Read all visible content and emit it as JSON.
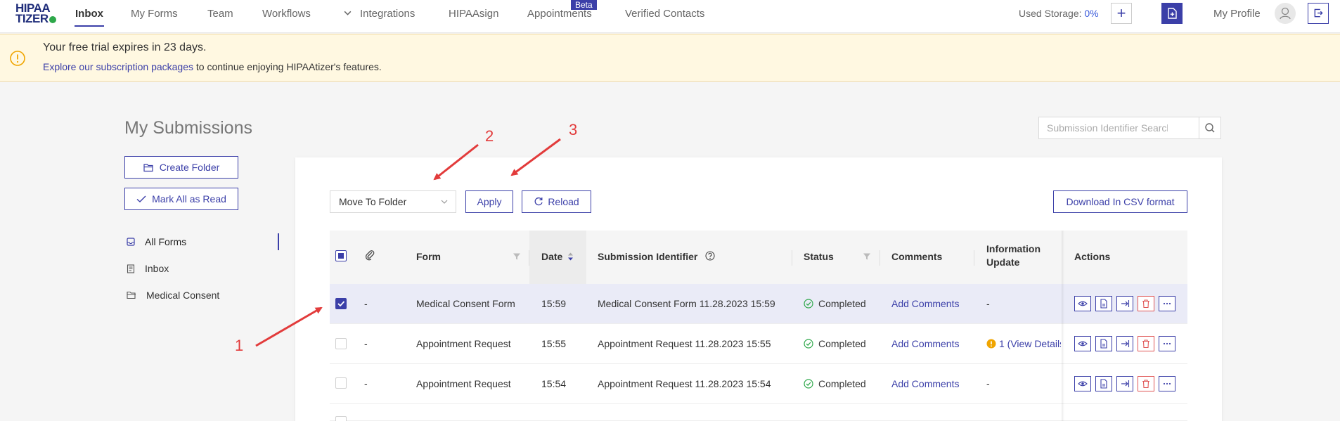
{
  "nav": {
    "logo_line1": "HIPAA",
    "logo_line2": "TIZER",
    "items": [
      "Inbox",
      "My Forms",
      "Team",
      "Workflows",
      "Integrations",
      "HIPAAsign",
      "Appointments",
      "Verified Contacts"
    ],
    "beta_badge": "Beta",
    "storage_label": "Used Storage:",
    "storage_value": "0%",
    "profile": "My Profile"
  },
  "banner": {
    "title": "Your free trial expires in 23 days.",
    "link": "Explore our subscription packages",
    "rest": " to continue enjoying HIPAAtizer's features."
  },
  "sidebar": {
    "title": "My Submissions",
    "create_folder": "Create Folder",
    "mark_all_read": "Mark All as Read",
    "folders": [
      "All Forms",
      "Inbox",
      "Medical Consent"
    ]
  },
  "search": {
    "placeholder": "Submission Identifier Search"
  },
  "toolbar": {
    "move_to_folder": "Move To Folder",
    "apply": "Apply",
    "reload": "Reload",
    "download_csv": "Download In CSV format"
  },
  "table": {
    "headers": {
      "form": "Form",
      "date": "Date",
      "identifier": "Submission Identifier",
      "status": "Status",
      "comments": "Comments",
      "info_line1": "Information",
      "info_line2": "Update",
      "actions": "Actions"
    },
    "rows": [
      {
        "attachment": "-",
        "form": "Medical Consent Form",
        "date": "15:59",
        "identifier": "Medical Consent Form 11.28.2023 15:59",
        "status": "Completed",
        "comments": "Add Comments",
        "info": "-",
        "selected": true
      },
      {
        "attachment": "-",
        "form": "Appointment Request",
        "date": "15:55",
        "identifier": "Appointment Request 11.28.2023 15:55",
        "status": "Completed",
        "comments": "Add Comments",
        "info": "1 (View Details",
        "selected": false
      },
      {
        "attachment": "-",
        "form": "Appointment Request",
        "date": "15:54",
        "identifier": "Appointment Request 11.28.2023 15:54",
        "status": "Completed",
        "comments": "Add Comments",
        "info": "-",
        "selected": false
      }
    ]
  },
  "annotations": [
    "1",
    "2",
    "3"
  ],
  "colors": {
    "accent": "#3b3fa8",
    "banner_bg": "#fff8e1",
    "status_ok": "#2ea84a",
    "annotation": "#e23b3b"
  }
}
